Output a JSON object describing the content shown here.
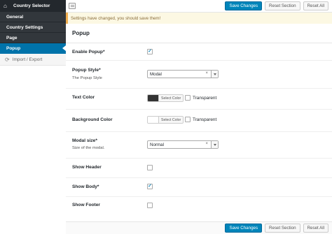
{
  "sidebar": {
    "title": "Country Selector",
    "items": [
      {
        "label": "General"
      },
      {
        "label": "Country Settings"
      },
      {
        "label": "Page"
      },
      {
        "label": "Popup"
      }
    ],
    "import_export": "Import / Export"
  },
  "toolbar": {
    "save_label": "Save Changes",
    "reset_section_label": "Reset Section",
    "reset_all_label": "Reset All"
  },
  "notice": "Settings have changed, you should save them!",
  "section_title": "Popup",
  "fields": {
    "enable_popup": {
      "label": "Enable Popup*",
      "checked": true
    },
    "popup_style": {
      "label": "Popup Style*",
      "description": "The Popup Style",
      "value": "Modal"
    },
    "text_color": {
      "label": "Text Color",
      "swatch": "#333333",
      "select_label": "Select Color",
      "transparent_label": "Transparent"
    },
    "background_color": {
      "label": "Background Color",
      "swatch": "#ffffff",
      "select_label": "Select Color",
      "transparent_label": "Transparent"
    },
    "modal_size": {
      "label": "Modal size*",
      "description": "Size of the modal.",
      "value": "Normal"
    },
    "show_header": {
      "label": "Show Header",
      "checked": false
    },
    "show_body": {
      "label": "Show Body*",
      "checked": true
    },
    "show_footer": {
      "label": "Show Footer",
      "checked": false
    }
  },
  "select_clear_glyph": "×",
  "check_glyph": "✓",
  "colors": {
    "accent": "#0085ba",
    "sidebar_dark": "#23282d",
    "active": "#0073aa"
  }
}
